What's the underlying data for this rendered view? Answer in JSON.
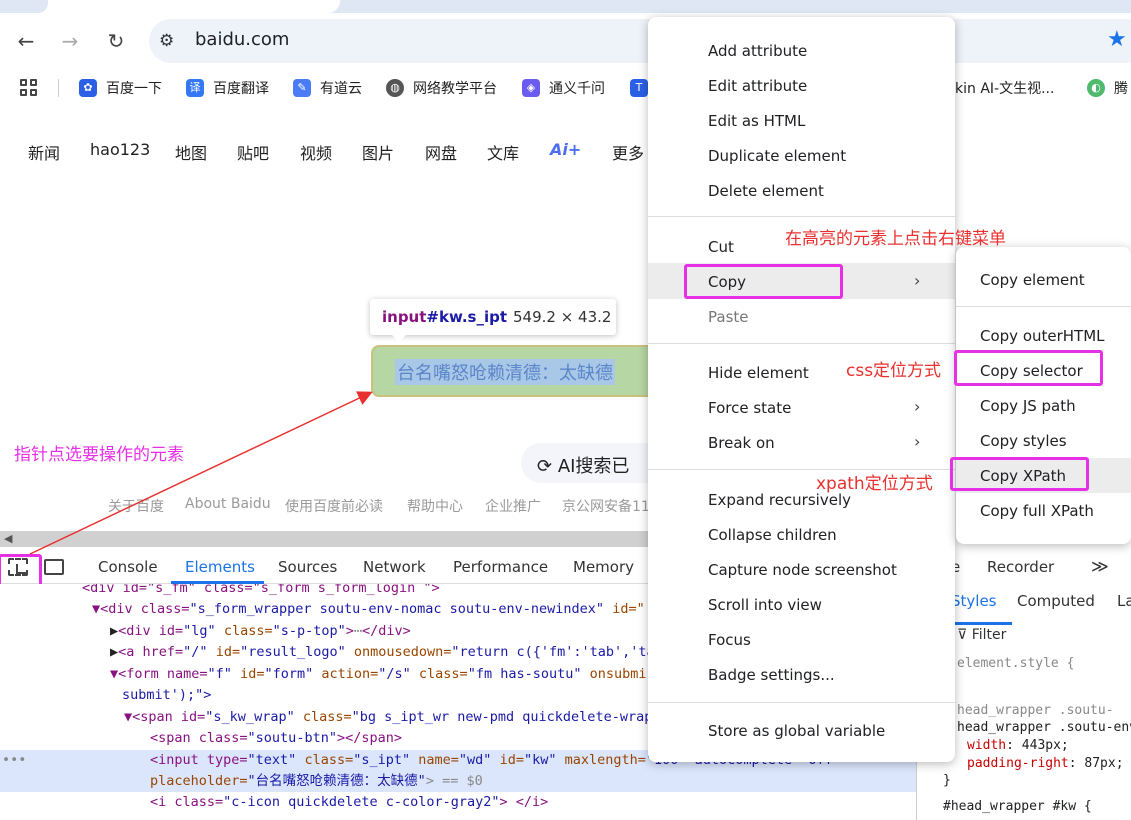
{
  "browser": {
    "url": "baidu.com",
    "bookmarks": [
      {
        "label": "百度一下",
        "color": "#2b5fe6"
      },
      {
        "label": "百度翻译",
        "color": "#3478f6"
      },
      {
        "label": "有道云",
        "color": "#4a7cf7"
      },
      {
        "label": "网络教学平台",
        "color": "#555555"
      },
      {
        "label": "通义千问",
        "color": "#6b5cf0"
      },
      {
        "label": "kin AI-文生视...",
        "color": "#ffffff"
      },
      {
        "label": "腾",
        "color": "#4fb96e"
      }
    ]
  },
  "page": {
    "nav": [
      "新闻",
      "hao123",
      "地图",
      "贴吧",
      "视频",
      "图片",
      "网盘",
      "文库",
      "Ai+",
      "更多"
    ],
    "search_placeholder": "台名嘴怒呛赖清德：太缺德",
    "ai_search": "AI搜索已",
    "footer": [
      "关于百度",
      "About Baidu",
      "使用百度前必读",
      "帮助中心",
      "企业推广",
      "京公网安备11"
    ]
  },
  "tooltip": {
    "tag": "input",
    "selector": "#kw.s_ipt",
    "size": "549.2 × 43.2"
  },
  "annotations": {
    "pointer_note": "指针点选要操作的元素",
    "menu_note": "在高亮的元素上点击右键菜单",
    "css_note": "css定位方式",
    "xpath_note": "xpath定位方式"
  },
  "devtools": {
    "tabs": [
      "Console",
      "Elements",
      "Sources",
      "Network",
      "Performance",
      "Memory"
    ],
    "right_tabs": [
      "e",
      "Recorder",
      "≫"
    ],
    "styles_tabs": [
      "Styles",
      "Computed",
      "La"
    ],
    "filter": "Filter",
    "dom": {
      "l0": "<div id=\"s_fm\" class=\"s_form s_form_login \">",
      "l1_tag": "<div class=",
      "l1_val": "\"s_form_wrapper  soutu-env-nomac soutu-env-newindex\"",
      "l1_id": " id=\"",
      "l2_a": "<div id=",
      "l2_b": "\"lg\"",
      "l2_c": " class=",
      "l2_d": "\"s-p-top\"",
      "l2_e": ">",
      "l2_f": "</div>",
      "l3_a": "<a href=",
      "l3_b": "\"/\"",
      "l3_c": " id=",
      "l3_d": "\"result_logo\"",
      "l3_e": " onmousedown=",
      "l3_f": "\"return c({'fm':'tab','ta",
      "l4_a": "<form name=",
      "l4_b": "\"f\"",
      "l4_c": " id=",
      "l4_d": "\"form\"",
      "l4_e": " action=",
      "l4_f": "\"/s\"",
      "l4_g": " class=",
      "l4_h": "\"fm  has-soutu\"",
      "l4_i": " onsubmi",
      "l5": "submit');\">",
      "l6_a": "<span id=",
      "l6_b": "\"s_kw_wrap\"",
      "l6_c": " class=",
      "l6_d": "\"bg s_ipt_wr new-pmd quickdelete-wrap",
      "l7_a": "<span class=",
      "l7_b": "\"soutu-btn\"",
      "l7_c": "></span>",
      "l8_a": "<input type=",
      "l8_b": "\"text\"",
      "l8_c": " class=",
      "l8_d": "\"s_ipt\"",
      "l8_e": " name=",
      "l8_f": "\"wd\"",
      "l8_g": " id=",
      "l8_h": "\"kw\"",
      "l8_i": " maxlength=",
      "l8_j": "\"100\" autocomplete=\"off\"",
      "l9_a": "placeholder=",
      "l9_b": "\"台名嘴怒呛赖清德：太缺德\"",
      "l9_c": "> == $0",
      "l10_a": "<i class=",
      "l10_b": "\"c-icon quickdelete c-color-gray2\"",
      "l10_c": "> </i>",
      "dots": "•••"
    },
    "css": {
      "r1": "element.style {",
      "r2": "head_wrapper .soutu-",
      "r3": "head_wrapper .soutu-env",
      "p1": "width",
      "v1": ": 443px;",
      "p2": "padding-right",
      "v2": ": 87px;",
      "close": "}",
      "r4": "#head_wrapper #kw {"
    }
  },
  "context_menu": {
    "items": [
      "Add attribute",
      "Edit attribute",
      "Edit as HTML",
      "Duplicate element",
      "Delete element",
      "Cut",
      "Copy",
      "Paste",
      "Hide element",
      "Force state",
      "Break on",
      "Expand recursively",
      "Collapse children",
      "Capture node screenshot",
      "Scroll into view",
      "Focus",
      "Badge settings...",
      "Store as global variable"
    ]
  },
  "copy_submenu": {
    "items": [
      "Copy element",
      "Copy outerHTML",
      "Copy selector",
      "Copy JS path",
      "Copy styles",
      "Copy XPath",
      "Copy full XPath"
    ]
  },
  "colors": {
    "highlight": "#e630e6",
    "note_red": "#e8312f",
    "accent": "#1a73e8"
  }
}
